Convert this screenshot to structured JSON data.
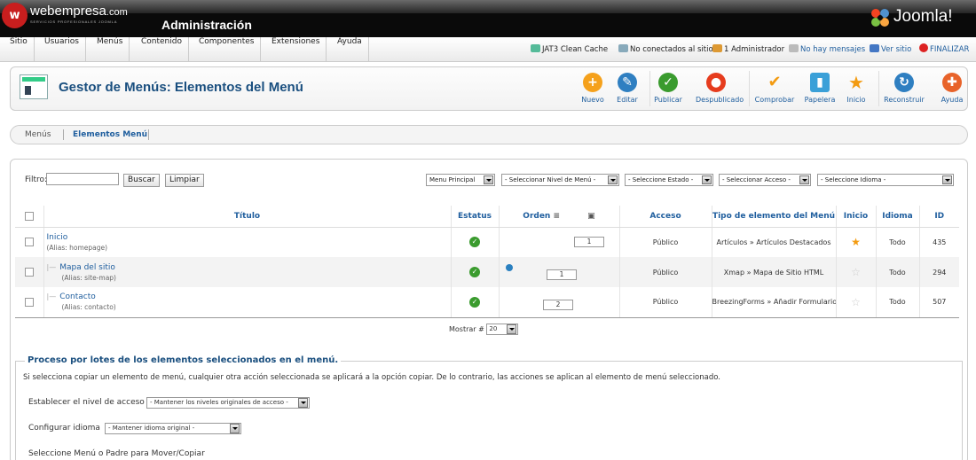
{
  "header": {
    "logo_mark": "w",
    "logo_name": "webempresa",
    "logo_suffix": ".com",
    "logo_tagline": "SERVICIOS PROFESIONALES JOOMLA",
    "title": "Administración",
    "joomla_brand": "Joomla!"
  },
  "menu": {
    "items": [
      "Sitio",
      "Usuarios",
      "Menús",
      "Contenido",
      "Componentes",
      "Extensiones",
      "Ayuda"
    ]
  },
  "status": {
    "cache": "JAT3 Clean Cache",
    "connected": "No conectados al sitio",
    "admins": "1 Administrador",
    "messages": "No hay mensajes",
    "view_site": "Ver sitio",
    "logout": "FINALIZAR"
  },
  "toolbar": {
    "page_title": "Gestor de Menús: Elementos del Menú",
    "new": "Nuevo",
    "edit": "Editar",
    "publish": "Publicar",
    "unpublish": "Despublicado",
    "check": "Comprobar",
    "trash": "Papelera",
    "home": "Inicio",
    "rebuild": "Reconstruir",
    "help": "Ayuda"
  },
  "submenu": {
    "menus": "Menús",
    "items": "Elementos Menú"
  },
  "filters": {
    "label": "Filtro:",
    "search_value": "",
    "search_button": "Buscar",
    "clear_button": "Limpiar",
    "menu_select": "Menu Principal",
    "level_select": "- Seleccionar Nivel de Menú -",
    "state_select": "- Seleccione Estado -",
    "access_select": "- Seleccionar Acceso -",
    "language_select": "- Seleccione Idioma -"
  },
  "table": {
    "headers": {
      "title": "Título",
      "status": "Estatus",
      "order": "Orden",
      "access": "Acceso",
      "type": "Tipo de elemento del Menú",
      "home": "Inicio",
      "language": "Idioma",
      "id": "ID"
    },
    "rows": [
      {
        "title": "Inicio",
        "alias": "(Alias: homepage)",
        "order": "1",
        "access": "Público",
        "type": "Artículos » Artículos Destacados",
        "language": "Todo",
        "id": "435"
      },
      {
        "title": "Mapa del sitio",
        "alias": "(Alias: site-map)",
        "order": "1",
        "access": "Público",
        "type": "Xmap » Mapa de Sitio HTML",
        "language": "Todo",
        "id": "294"
      },
      {
        "title": "Contacto",
        "alias": "(Alias: contacto)",
        "order": "2",
        "access": "Público",
        "type": "BreezingForms » Añadir Formulario",
        "language": "Todo",
        "id": "507"
      }
    ]
  },
  "pagination": {
    "label": "Mostrar #",
    "value": "20"
  },
  "batch": {
    "legend": "Proceso por lotes de los elementos seleccionados en el menú.",
    "description": "Si selecciona copiar un elemento de menú, cualquier otra acción seleccionada se aplicará a la opción copiar. De lo contrario, las acciones se aplican al elemento de menú seleccionado.",
    "access_label": "Establecer el nivel de acceso",
    "access_value": "- Mantener los niveles originales de acceso -",
    "language_label": "Configurar idioma",
    "language_value": "- Mantener idioma original -",
    "move_label": "Seleccione Menú o Padre para Mover/Copiar"
  },
  "colors": {
    "header_bg": "#0a0a0a",
    "link_blue": "#1f5e9e",
    "title_blue": "#1a4f7f",
    "green": "#3a9b2e",
    "orange": "#f39b11",
    "red": "#e63c1e"
  }
}
